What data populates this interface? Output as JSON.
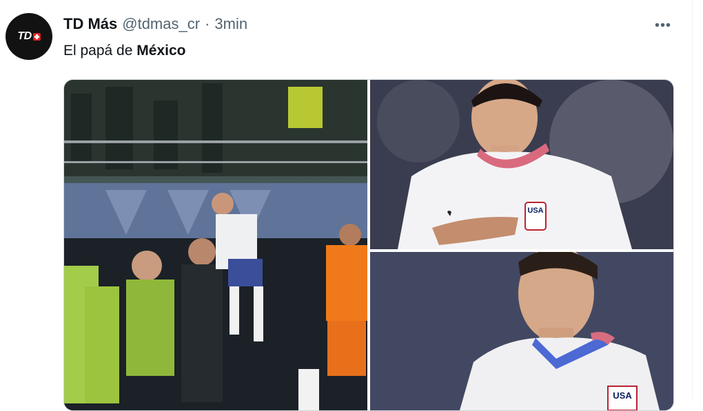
{
  "tweet": {
    "author_name": "TD Más",
    "handle": "@tdmas_cr",
    "separator": "·",
    "time": "3min",
    "more_label": "•••",
    "text_prefix": "El papá de ",
    "text_bold": "México",
    "avatar_label": "TD"
  },
  "media": {
    "photos": [
      {
        "desc": "celebration-photo"
      },
      {
        "desc": "player-pointing-crest-photo"
      },
      {
        "desc": "player-portrait-photo"
      }
    ],
    "jersey_crest_text": "USA"
  }
}
